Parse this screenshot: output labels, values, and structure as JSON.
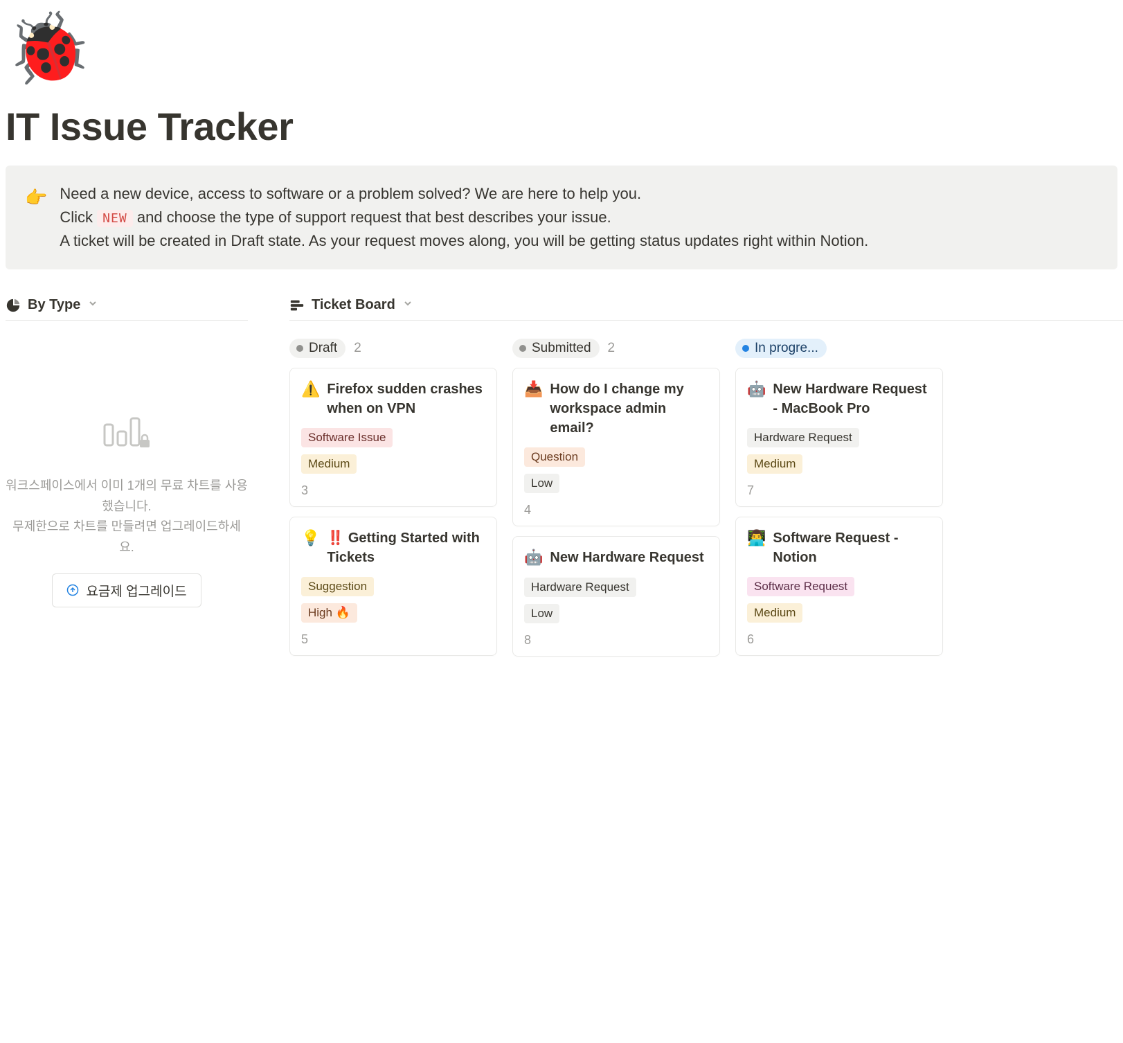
{
  "page": {
    "icon": "🐞",
    "title": "IT Issue Tracker"
  },
  "callout": {
    "emoji": "👉",
    "line1": "Need a new device, access to software or a problem solved? We are here to help you.",
    "line2_before": "Click ",
    "line2_code": "NEW",
    "line2_after": " and choose the type of support request that best describes your issue.",
    "line3": "A ticket will be created in Draft state. As your request moves along, you will be getting status updates right within Notion."
  },
  "left": {
    "view_label": "By Type",
    "empty_line1": "워크스페이스에서 이미 1개의 무료 차트를 사용했습니다.",
    "empty_line2": "무제한으로 차트를 만들려면 업그레이드하세요.",
    "upgrade_label": "요금제 업그레이드"
  },
  "right": {
    "view_label": "Ticket Board"
  },
  "columns": [
    {
      "status": "Draft",
      "pill_class": "gray",
      "dot_class": "gray",
      "count": "2",
      "cards": [
        {
          "emoji": "⚠️",
          "title": "Firefox sudden crashes when on VPN",
          "tags": [
            {
              "text": "Software Issue",
              "cls": "red-soft"
            },
            {
              "text": "Medium",
              "cls": "yellow-soft"
            }
          ],
          "number": "3"
        },
        {
          "emoji": "💡",
          "title": "‼️ Getting Started with Tickets",
          "tags": [
            {
              "text": "Suggestion",
              "cls": "yellow-soft"
            },
            {
              "text": "High 🔥",
              "cls": "orange-soft"
            }
          ],
          "number": "5"
        }
      ]
    },
    {
      "status": "Submitted",
      "pill_class": "gray",
      "dot_class": "gray",
      "count": "2",
      "cards": [
        {
          "emoji": "📥",
          "title": "How do I change my workspace admin email?",
          "tags": [
            {
              "text": "Question",
              "cls": "orange-soft"
            },
            {
              "text": "Low",
              "cls": "gray-soft"
            }
          ],
          "number": "4"
        },
        {
          "emoji": "🤖",
          "title": "New Hardware Request",
          "tags": [
            {
              "text": "Hardware Request",
              "cls": "gray-soft"
            },
            {
              "text": "Low",
              "cls": "gray-soft"
            }
          ],
          "number": "8"
        }
      ]
    },
    {
      "status": "In progre...",
      "pill_class": "blue",
      "dot_class": "blue",
      "count": "",
      "cards": [
        {
          "emoji": "🤖",
          "title": "New Hardware Request - MacBook Pro",
          "tags": [
            {
              "text": "Hardware Request",
              "cls": "gray-soft"
            },
            {
              "text": "Medium",
              "cls": "yellow-soft"
            }
          ],
          "number": "7"
        },
        {
          "emoji": "👨‍💻",
          "title": "Software Request - Notion",
          "tags": [
            {
              "text": "Software Request",
              "cls": "pink-soft"
            },
            {
              "text": "Medium",
              "cls": "yellow-soft"
            }
          ],
          "number": "6"
        }
      ]
    }
  ]
}
